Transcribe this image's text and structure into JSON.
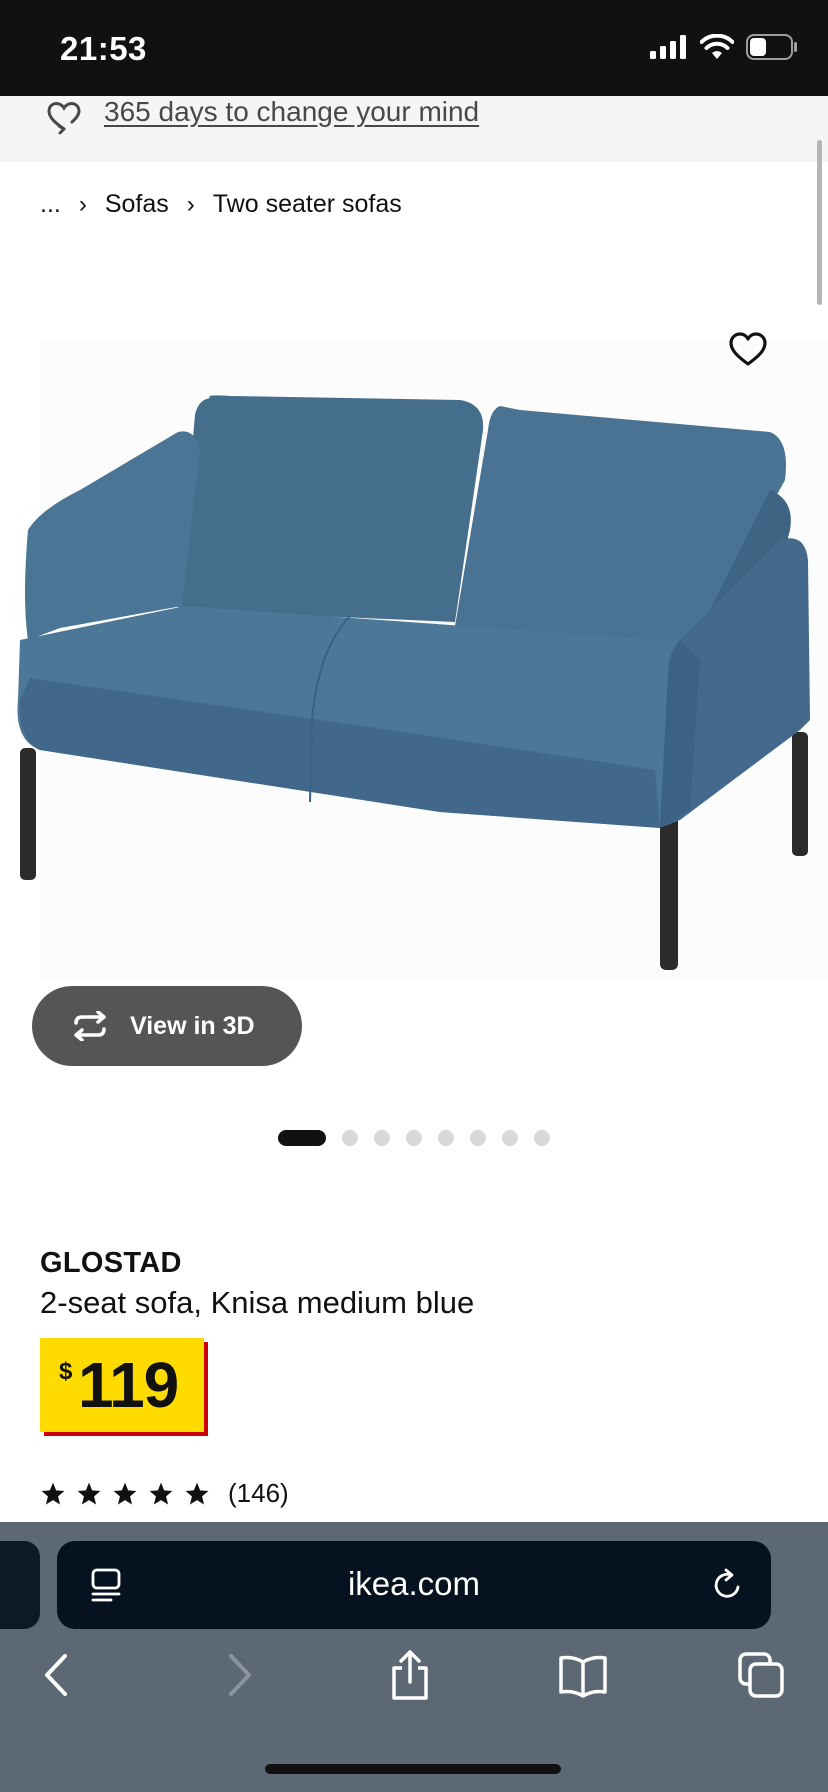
{
  "status_bar": {
    "time": "21:53"
  },
  "promo": {
    "text": "365 days to change your mind",
    "icon": "refresh-heart-icon"
  },
  "breadcrumb": {
    "ellipsis": "...",
    "items": [
      "Sofas",
      "Two seater sofas"
    ],
    "separator": "›"
  },
  "product": {
    "name": "GLOSTAD",
    "description": "2-seat sofa, Knisa medium blue",
    "currency": "$",
    "price": "119",
    "rating": 5,
    "review_count": "(146)",
    "color": "#46708f"
  },
  "view3d": {
    "label": "View in 3D"
  },
  "carousel": {
    "total": 8,
    "active_index": 0
  },
  "browser": {
    "url": "ikea.com"
  },
  "colors": {
    "price_bg": "#ffdb00",
    "price_shadow": "#cc0008",
    "status_bar": "#111111",
    "browser_bar": "#5c6874"
  }
}
